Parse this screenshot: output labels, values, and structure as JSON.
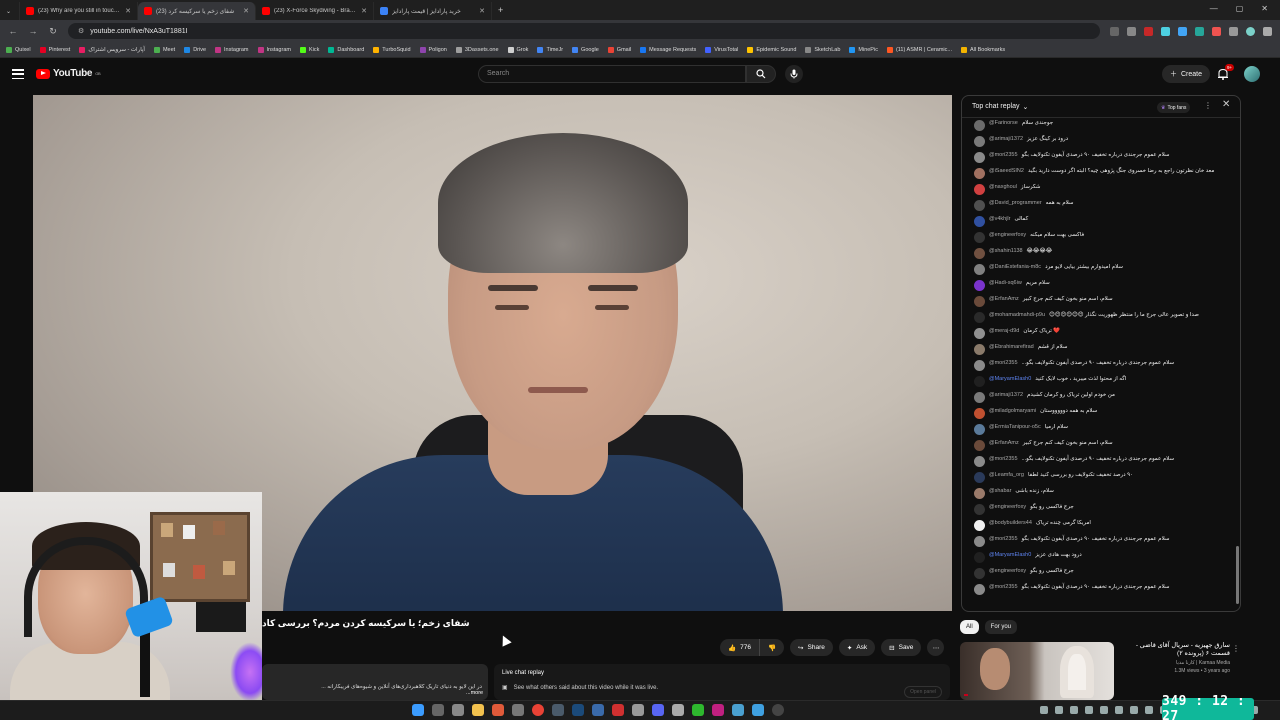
{
  "browser": {
    "tabs": [
      {
        "title": "(23) Why are you still in touch w",
        "active": false
      },
      {
        "title": "(23) شفای زخم یا سرکیسه کرد",
        "active": true
      },
      {
        "title": "(23) X-Force Skydiving - Brad P",
        "active": false
      },
      {
        "title": "خرید پارادایز | قیمت پارادایز",
        "active": false
      }
    ],
    "url": "youtube.com/live/NxA3uT1881I",
    "bookmarks": [
      "Quixel",
      "Pinterest",
      "آپارات - سرویس اشتراک",
      "Meet",
      "Drive",
      "Instagram",
      "Instagram",
      "Kick",
      "Dashboard",
      "TurboSquid",
      "Poligon",
      "3Dassets.one",
      "Grok",
      "TimeJr",
      "Google",
      "Gmail",
      "Message Requests",
      "VirusTotal",
      "Epidemic Sound",
      "SketchLab",
      "MinePic",
      "(11) ASMR | Ceramic...",
      "All Bookmarks"
    ]
  },
  "youtube": {
    "logo_text": "YouTube",
    "logo_region": "GB",
    "search_placeholder": "Search",
    "create_label": "Create",
    "notifications": "9+"
  },
  "video": {
    "title": "شفای زخم؛ یا سرکیسه کردن مردم؟ بررسی کاد",
    "like_count": "776",
    "share_label": "Share",
    "ask_label": "Ask",
    "save_label": "Save",
    "description": "در این لایو به دنیای تاریک کلاهبرداری‌های آنلاین و شیوه‌های فریبکارانه ...",
    "more_label": "...more"
  },
  "live_chat_replay": {
    "title": "Live chat replay",
    "subtitle": "See what others said about this video while it was live.",
    "open_panel": "Open panel"
  },
  "chat": {
    "header": "Top chat replay",
    "top_fans": "Top fans",
    "messages": [
      {
        "user": "@Farinorse",
        "text": "جوجندی سلام",
        "color": "#6b6b6b"
      },
      {
        "user": "@arimaji1372",
        "text": "درود بر کینگ عزیز",
        "color": "#7a7a7a"
      },
      {
        "user": "@mori2355",
        "text": "سلام عموم جرجندی درباره تخفیف ۹۰ درصدی آیفون تکنولایف بگو",
        "color": "#8a8a8a"
      },
      {
        "user": "@iSaeedSIN2",
        "text": "معد خان نظرتون راجع به رضا خسروی جنگ پژوهی چیه؟ البته اگر دوست دارید بگید",
        "color": "#a07060"
      },
      {
        "user": "@naxghoul",
        "text": "شکرساز",
        "color": "#d04040"
      },
      {
        "user": "@David_programmer",
        "text": "سلام به همه",
        "color": "#505050"
      },
      {
        "user": "@v4khjlr",
        "text": "کمالی",
        "color": "#3050a0"
      },
      {
        "user": "@engineerfoxy",
        "text": "فاکسی بهت سلام میکنه",
        "color": "#333333"
      },
      {
        "user": "@shahin1138",
        "text": "😂😂😂😂",
        "color": "#705040"
      },
      {
        "user": "@DaniEstefania-m8c",
        "text": "سلام امیدوارم بیشتر بیایی لایو مرد",
        "color": "#808080"
      },
      {
        "user": "@Hadi-sq6iw",
        "text": "سلام مریم",
        "color": "#7a33cc"
      },
      {
        "user": "@ErfanAmz",
        "text": "سلام، اسم منو بخون کیف کنم جرج کبیر",
        "color": "#6a4a3a"
      },
      {
        "user": "@mohamadmahdi-p9u",
        "text": "صدا و تصویر عالی جرج ما را منتظر ظهوریت نگذار 😊😊😊😊😊😊",
        "color": "#2a2a2a"
      },
      {
        "user": "@meraj-d9d",
        "text": "❤️ تریاک کرمان",
        "color": "#909090"
      },
      {
        "user": "@Ebrahimarefirad",
        "text": "سلام از قشم",
        "color": "#8a7a6a"
      },
      {
        "user": "@mori2355",
        "text": "سلام عموم جرجندی درباره تخفیف ۹۰ درصدی آیفون تکنولایف بگو...",
        "color": "#8a8a8a"
      },
      {
        "user": "@MaryamElash0",
        "text": "اگه از محتوا لذت میبرید ، خوب لایک کنید",
        "color": "#202020",
        "mod": true
      },
      {
        "user": "@arimaji1372",
        "text": "من خودم اولین تریاک رو کرمان کشیدم",
        "color": "#7a7a7a"
      },
      {
        "user": "@miladgolmaryami",
        "text": "سلام به همه دوووووستان",
        "color": "#c05030"
      },
      {
        "user": "@ErmiaTanipour-o5c",
        "text": "سلام ارمیا",
        "color": "#5a7a9a"
      },
      {
        "user": "@ErfanAmz",
        "text": "سلام، اسم منو بخون کیف کنم جرج کبیر",
        "color": "#6a4a3a"
      },
      {
        "user": "@mori2355",
        "text": "سلام عموم جرجندی درباره تخفیف ۹۰ درصدی آیفون تکنولایف بگو...",
        "color": "#8a8a8a"
      },
      {
        "user": "@Leamfa_org",
        "text": "۹۰ درصد تخفیف تکنولایف رو بررسی کنید لطفا",
        "color": "#2a3a5a"
      },
      {
        "user": "@shabar",
        "text": "سلام، زنده باشی",
        "color": "#9a7a6a"
      },
      {
        "user": "@engineerfoxy",
        "text": "جرج فاکسی رو بگو",
        "color": "#333333"
      },
      {
        "user": "@bodybuilders44",
        "text": "امریکا گرمی چنده تریاک",
        "color": "#f0f0f0"
      },
      {
        "user": "@mori2355",
        "text": "سلام عموم جرجندی درباره تخفیف ۹۰ درصدی آیفون تکنولایف بگو",
        "color": "#8a8a8a"
      },
      {
        "user": "@MaryamElash0",
        "text": "درود بهت هادی عزیز",
        "color": "#202020",
        "mod": true
      },
      {
        "user": "@engineerfoxy",
        "text": "جرج فاکسی رو بگو",
        "color": "#333333"
      },
      {
        "user": "@mori2355",
        "text": "سلام عموم جرجندی درباره تخفیف ۹۰ درصدی آیفون تکنولایف بگو",
        "color": "#8a8a8a"
      }
    ]
  },
  "chips": [
    "All",
    "For you"
  ],
  "recommendation": {
    "title": "سارق جهیزیه - سریال آقای قاضی - قسمت ۶ (پرونده ۲)",
    "channel": "Karnaa Media | کارنا مدیا",
    "meta": "1.3M views • 3 years ago"
  },
  "overlay_clock": "349 : 12 : 27"
}
